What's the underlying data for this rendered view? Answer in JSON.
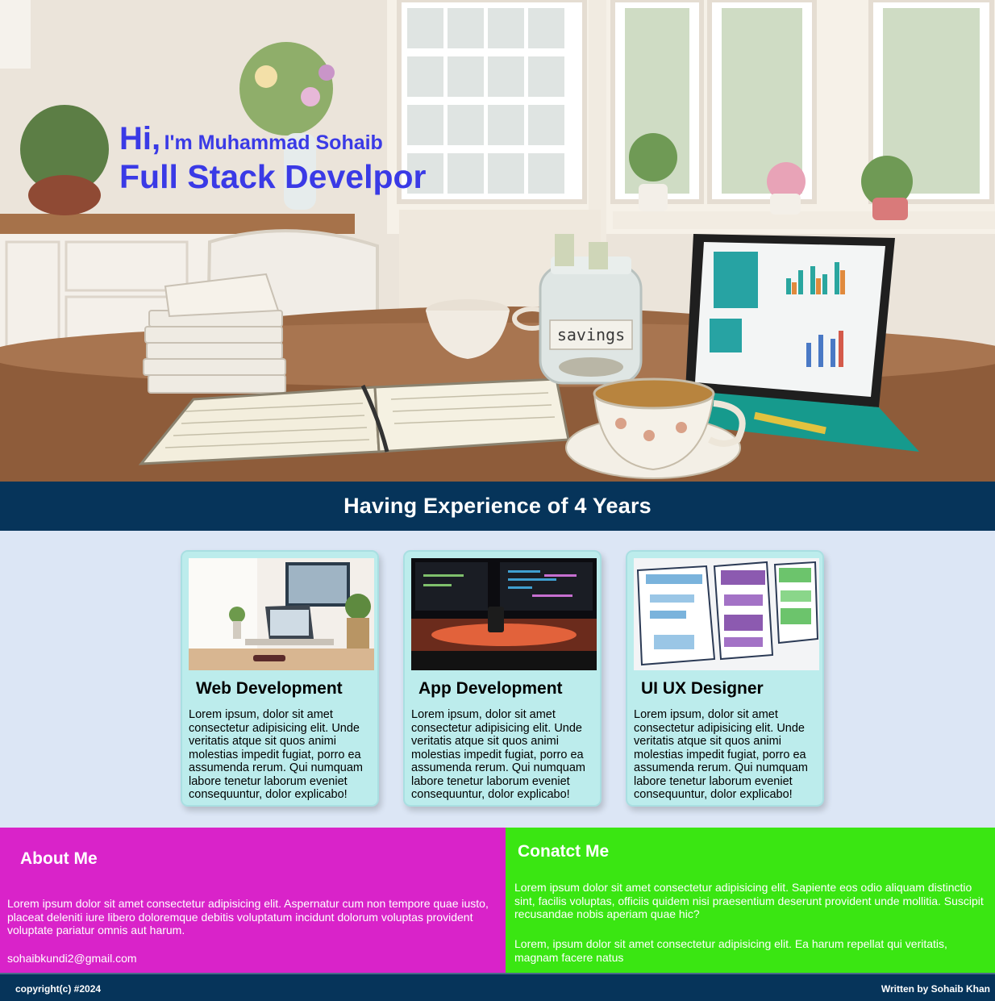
{
  "hero": {
    "greeting_hi": "Hi,",
    "greeting_name": "I'm Muhammad Sohaib",
    "role": "Full Stack Develpor",
    "jar_label": "savings"
  },
  "experience": {
    "heading": "Having Experience of 4 Years"
  },
  "services": [
    {
      "title": "Web Development",
      "description": "Lorem ipsum, dolor sit amet consectetur adipisicing elit. Unde veritatis atque sit quos animi molestias impedit fugiat, porro ea assumenda rerum. Qui numquam labore tenetur laborum eveniet consequuntur, dolor explicabo!"
    },
    {
      "title": "App Development",
      "description": "Lorem ipsum, dolor sit amet consectetur adipisicing elit. Unde veritatis atque sit quos animi molestias impedit fugiat, porro ea assumenda rerum. Qui numquam labore tenetur laborum eveniet consequuntur, dolor explicabo!"
    },
    {
      "title": "UI UX Designer",
      "description": "Lorem ipsum, dolor sit amet consectetur adipisicing elit. Unde veritatis atque sit quos animi molestias impedit fugiat, porro ea assumenda rerum. Qui numquam labore tenetur laborum eveniet consequuntur, dolor explicabo!"
    }
  ],
  "about": {
    "heading": "About Me",
    "text": "Lorem ipsum dolor sit amet consectetur adipisicing elit. Aspernatur cum non tempore quae iusto, placeat deleniti iure libero doloremque debitis voluptatum incidunt dolorum voluptas provident voluptate pariatur omnis aut harum.",
    "email": "sohaibkundi2@gmail.com"
  },
  "contact": {
    "heading": "Conatct Me",
    "paragraph1": "Lorem ipsum dolor sit amet consectetur adipisicing elit. Sapiente eos odio aliquam distinctio sint, facilis voluptas, officiis quidem nisi praesentium deserunt provident unde mollitia. Suscipit recusandae nobis aperiam quae hic?",
    "paragraph2": "Lorem, ipsum dolor sit amet consectetur adipisicing elit. Ea harum repellat qui veritatis, magnam facere natus"
  },
  "footer": {
    "copyright": "copyright(c) #2024",
    "author": "Written by Sohaib Khan"
  },
  "colors": {
    "heading_blue": "#3a3ae6",
    "navy": "#06345a",
    "card_bg": "#bcecec",
    "about_bg": "#d923c9",
    "contact_bg": "#3ae612",
    "page_bg": "#dce6f5"
  }
}
